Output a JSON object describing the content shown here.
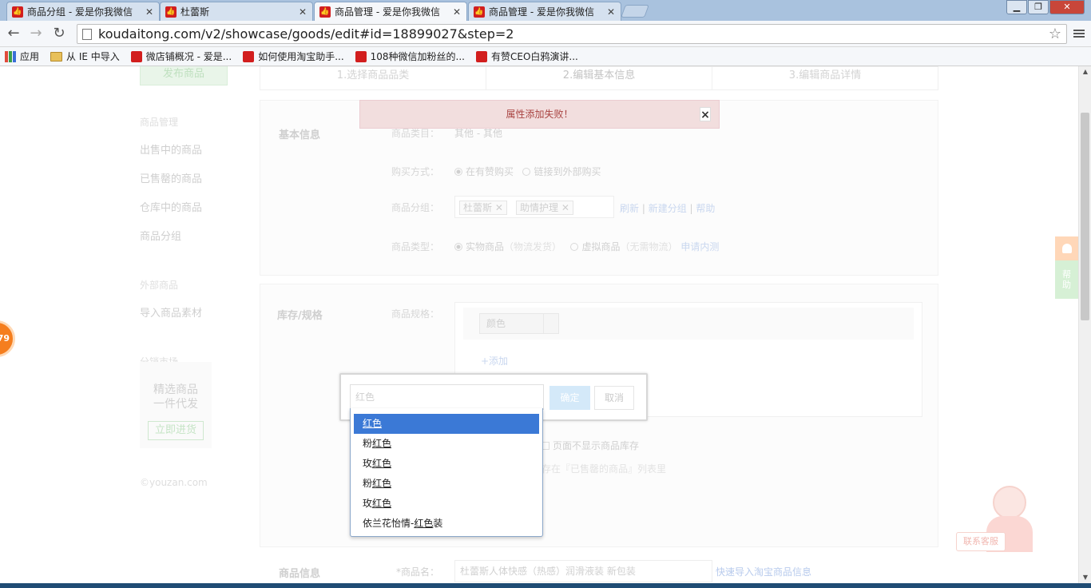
{
  "browser": {
    "tabs": [
      {
        "title": "商品分组 - 爱是你我微信"
      },
      {
        "title": "杜蕾斯"
      },
      {
        "title": "商品管理 - 爱是你我微信"
      },
      {
        "title": "商品管理 - 爱是你我微信"
      }
    ],
    "url": "koudaitong.com/v2/showcase/goods/edit#id=18899027&step=2",
    "bookmarks": [
      {
        "label": "应用"
      },
      {
        "label": "从 IE 中导入"
      },
      {
        "label": "微店铺概况 - 爱是..."
      },
      {
        "label": "如何使用淘宝助手..."
      },
      {
        "label": "108种微信加粉丝的..."
      },
      {
        "label": "有赞CEO白鸦演讲..."
      }
    ]
  },
  "sidebar": {
    "publish_button": "发布商品",
    "group1_header": "商品管理",
    "items": [
      "出售中的商品",
      "已售罄的商品",
      "仓库中的商品",
      "商品分组"
    ],
    "group2_header": "外部商品",
    "import_item": "导入商品素材",
    "group3_header": "分销市场",
    "promo_text": "精选商品\n一件代发",
    "promo_button": "立即进货",
    "copyright": "©youzan.com"
  },
  "steps": [
    "1.选择商品品类",
    "2.编辑基本信息",
    "3.编辑商品详情"
  ],
  "alert": {
    "message": "属性添加失败！",
    "close": "×"
  },
  "basic": {
    "section_title": "基本信息",
    "category_label": "商品类目：",
    "category_value": "其他 - 其他",
    "buy_label": "购买方式：",
    "buy_opt1": "在有赞购买",
    "buy_opt2": "链接到外部购买",
    "group_label": "商品分组：",
    "tags": [
      "杜蕾斯",
      "助情护理"
    ],
    "refresh": "刷新",
    "new_group": "新建分组",
    "help": "帮助",
    "type_label": "商品类型：",
    "type_opt1": "实物商品",
    "type_opt1_note": "（物流发货）",
    "type_opt2": "虚拟商品",
    "type_opt2_note": "（无需物流）",
    "apply_test": "申请内测"
  },
  "stock": {
    "section_title": "库存/规格",
    "spec_label": "商品规格：",
    "spec_select": "颜色",
    "add_link": "+添加",
    "hide_stock": "页面不显示商品库存",
    "soldout_note": "存在『已售罄的商品』列表里"
  },
  "popup": {
    "input_value": "红色",
    "confirm": "确定",
    "cancel": "取消"
  },
  "dropdown": {
    "options": [
      {
        "pre": "",
        "match": "红色",
        "post": ""
      },
      {
        "pre": "粉",
        "match": "红色",
        "post": ""
      },
      {
        "pre": "玫",
        "match": "红色",
        "post": ""
      },
      {
        "pre": "粉",
        "match": "红色",
        "post": ""
      },
      {
        "pre": "玫",
        "match": "红色",
        "post": ""
      },
      {
        "pre": "依兰花怡情-",
        "match": "红色",
        "post": "装"
      }
    ],
    "highlighted_index": 0
  },
  "goods": {
    "section_title": "商品信息",
    "name_label": "*商品名：",
    "name_value": "杜蕾斯人体快感（热感）润滑液装 新包装",
    "taobao_link": "快速导入淘宝商品信息"
  },
  "floating": {
    "badge": "79",
    "help_tab": "帮\n助",
    "customer_service": "联系客服"
  },
  "colors": {
    "accent": "#3b79d6",
    "alert_bg": "#f2dede",
    "alert_text": "#a94442"
  }
}
